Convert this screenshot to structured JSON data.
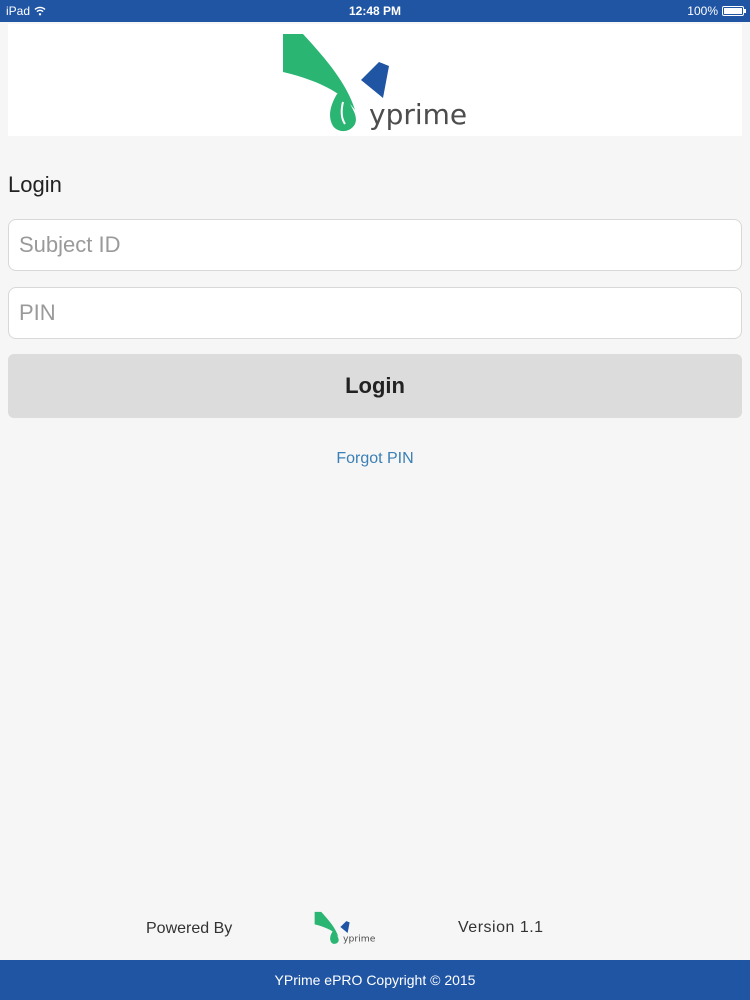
{
  "status_bar": {
    "device": "iPad",
    "time": "12:48 PM",
    "battery": "100%"
  },
  "brand": {
    "logo_text": "yprime",
    "green": "#2ab573",
    "blue": "#2055a4"
  },
  "login_form": {
    "title": "Login",
    "subject_id_placeholder": "Subject ID",
    "pin_placeholder": "PIN",
    "login_button": "Login",
    "forgot_pin": "Forgot PIN"
  },
  "footer": {
    "powered_by": "Powered By",
    "version": "Version 1.1",
    "copyright": "YPrime ePRO Copyright © 2015"
  },
  "icons": [
    "wifi-icon",
    "battery-icon"
  ]
}
